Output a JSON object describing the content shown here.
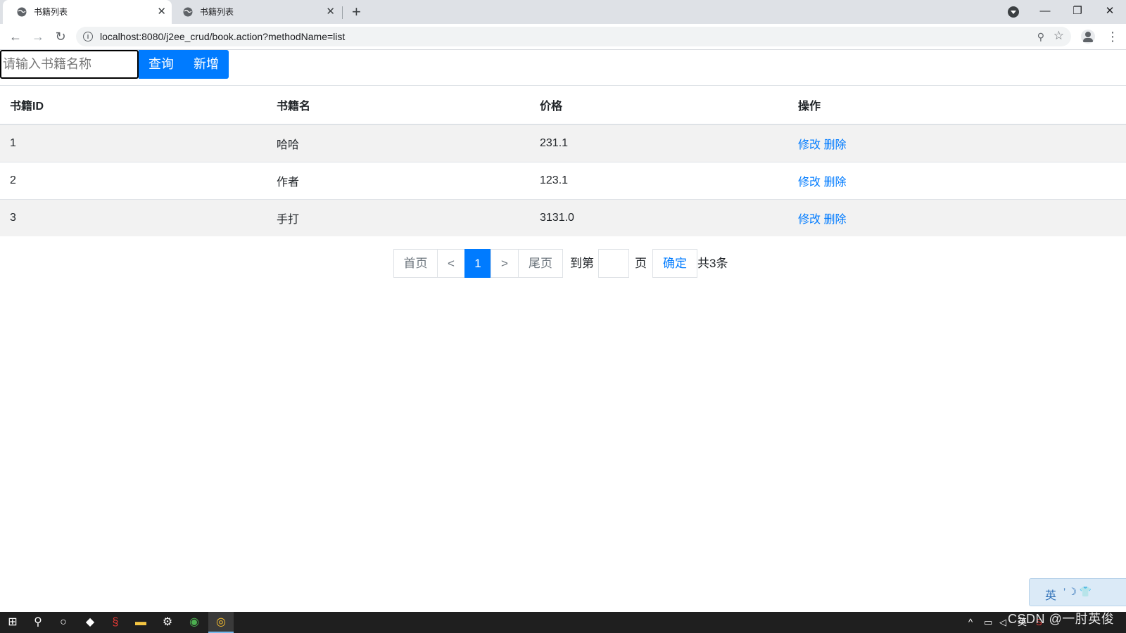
{
  "browser": {
    "tabs": [
      {
        "title": "书籍列表",
        "active": true
      },
      {
        "title": "书籍列表",
        "active": false
      }
    ],
    "url": "localhost:8080/j2ee_crud/book.action?methodName=list"
  },
  "search": {
    "placeholder": "请输入书籍名称",
    "query_label": "查询",
    "add_label": "新增"
  },
  "table": {
    "headers": [
      "书籍ID",
      "书籍名",
      "价格",
      "操作"
    ],
    "rows": [
      {
        "id": "1",
        "name": "哈哈",
        "price": "231.1",
        "edit": "修改",
        "delete": "删除"
      },
      {
        "id": "2",
        "name": "作者",
        "price": "123.1",
        "edit": "修改",
        "delete": "删除"
      },
      {
        "id": "3",
        "name": "手打",
        "price": "3131.0",
        "edit": "修改",
        "delete": "删除"
      }
    ]
  },
  "pagination": {
    "first": "首页",
    "prev": "<",
    "current": "1",
    "next": ">",
    "last": "尾页",
    "goto_prefix": "到第",
    "goto_suffix": "页",
    "confirm": "确定",
    "total": "共3条"
  },
  "ime": {
    "lang": "英"
  },
  "taskbar": {
    "tray_lang": "英",
    "watermark": "CSDN @一肘英俊"
  },
  "colors": {
    "primary": "#007bff",
    "stripe": "#f2f2f2"
  }
}
